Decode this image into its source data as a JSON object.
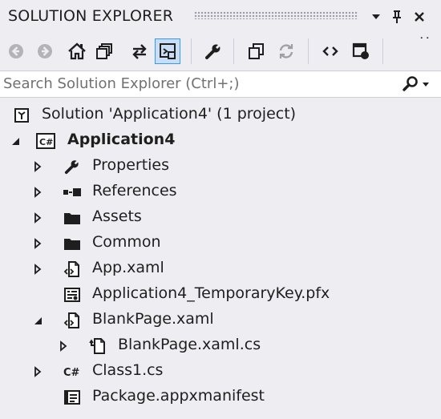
{
  "panel": {
    "title": "SOLUTION EXPLORER"
  },
  "toolbar": {
    "buttons": [
      {
        "name": "back-button",
        "icon": "back-arrow-icon"
      },
      {
        "name": "forward-button",
        "icon": "forward-arrow-icon"
      },
      {
        "name": "home-button",
        "icon": "home-icon"
      },
      {
        "name": "pending-changes-filter-button",
        "icon": "stacked-windows-icon"
      },
      {
        "name": "sync-with-active-document-button",
        "icon": "sync-arrows-icon"
      },
      {
        "name": "show-all-files-button",
        "icon": "show-all-files-icon"
      },
      {
        "name": "properties-button",
        "icon": "wrench-icon"
      },
      {
        "name": "collapse-all-button",
        "icon": "collapse-all-icon"
      },
      {
        "name": "refresh-button",
        "icon": "refresh-icon"
      },
      {
        "name": "view-code-button",
        "icon": "code-brackets-icon"
      },
      {
        "name": "view-designer-button",
        "icon": "designer-icon"
      }
    ],
    "overflow_label": "˙˙"
  },
  "search": {
    "placeholder": "Search Solution Explorer (Ctrl+;)"
  },
  "tree": {
    "solution": {
      "label": "Solution 'Application4' (1 project)",
      "icon": "solution-icon"
    },
    "project": {
      "label": "Application4",
      "icon": "csharp-project-icon",
      "expanded": true
    },
    "items": [
      {
        "label": "Properties",
        "icon": "wrench-icon",
        "expander": "collapsed"
      },
      {
        "label": "References",
        "icon": "references-icon",
        "expander": "collapsed"
      },
      {
        "label": "Assets",
        "icon": "folder-icon",
        "expander": "collapsed"
      },
      {
        "label": "Common",
        "icon": "folder-icon",
        "expander": "collapsed"
      },
      {
        "label": "App.xaml",
        "icon": "xaml-file-icon",
        "expander": "collapsed"
      },
      {
        "label": "Application4_TemporaryKey.pfx",
        "icon": "certificate-icon",
        "expander": "none"
      },
      {
        "label": "BlankPage.xaml",
        "icon": "xaml-file-icon",
        "expander": "expanded"
      },
      {
        "label": "BlankPage.xaml.cs",
        "icon": "code-behind-file-icon",
        "expander": "collapsed"
      },
      {
        "label": "Class1.cs",
        "icon": "csharp-file-icon",
        "expander": "collapsed"
      },
      {
        "label": "Package.appxmanifest",
        "icon": "manifest-icon",
        "expander": "none"
      }
    ]
  },
  "colors": {
    "background": "#eeeef2",
    "active_button_border": "#3399ff",
    "active_button_fill": "#c9def5",
    "text": "#1e1e1e",
    "disabled_icon": "#a0a0a0"
  }
}
